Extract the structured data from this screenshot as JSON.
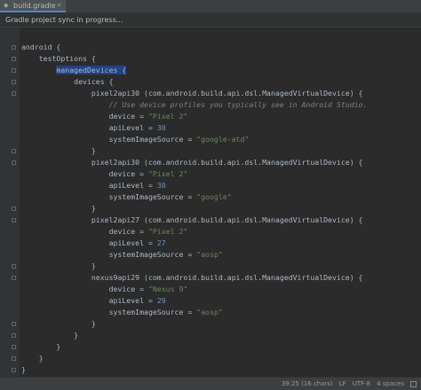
{
  "tab": {
    "label": "build.gradle",
    "icon": "gradle-file-icon"
  },
  "notice": {
    "text": "Gradle project sync in progress..."
  },
  "code": [
    {
      "t": ""
    },
    {
      "t": "android {"
    },
    {
      "t": "    testOptions {"
    },
    {
      "t": "        managedDevices {",
      "sel": "managedDevices"
    },
    {
      "t": "            devices {"
    },
    {
      "t": "                pixel2api30 (com.android.build.api.dsl.ManagedVirtualDevice) {"
    },
    {
      "t": "                    // Use device profiles you typically see in Android Studio.",
      "cmt": true
    },
    {
      "t": "                    device = \"Pixel 2\""
    },
    {
      "t": "                    apiLevel = 30"
    },
    {
      "t": "                    systemImageSource = \"google-atd\""
    },
    {
      "t": "                }"
    },
    {
      "t": "                pixel2api30 (com.android.build.api.dsl.ManagedVirtualDevice) {"
    },
    {
      "t": "                    device = \"Pixel 2\""
    },
    {
      "t": "                    apiLevel = 30"
    },
    {
      "t": "                    systemImageSource = \"google\""
    },
    {
      "t": "                }"
    },
    {
      "t": "                pixel2api27 (com.android.build.api.dsl.ManagedVirtualDevice) {"
    },
    {
      "t": "                    device = \"Pixel 2\""
    },
    {
      "t": "                    apiLevel = 27"
    },
    {
      "t": "                    systemImageSource = \"aosp\""
    },
    {
      "t": "                }"
    },
    {
      "t": "                nexus9api29 (com.android.build.api.dsl.ManagedVirtualDevice) {"
    },
    {
      "t": "                    device = \"Nexus 9\""
    },
    {
      "t": "                    apiLevel = 29"
    },
    {
      "t": "                    systemImageSource = \"aosp\""
    },
    {
      "t": "                }"
    },
    {
      "t": "            }"
    },
    {
      "t": "        }"
    },
    {
      "t": "    }"
    },
    {
      "t": "}"
    }
  ],
  "status": {
    "position": "39:25 (16 chars)",
    "line_sep": "LF",
    "encoding": "UTF-8",
    "indent": "4 spaces"
  },
  "colors": {
    "string": "#6a8759",
    "number": "#6897bb",
    "comment": "#808080",
    "selection": "#214283",
    "text": "#a9b7c6"
  }
}
